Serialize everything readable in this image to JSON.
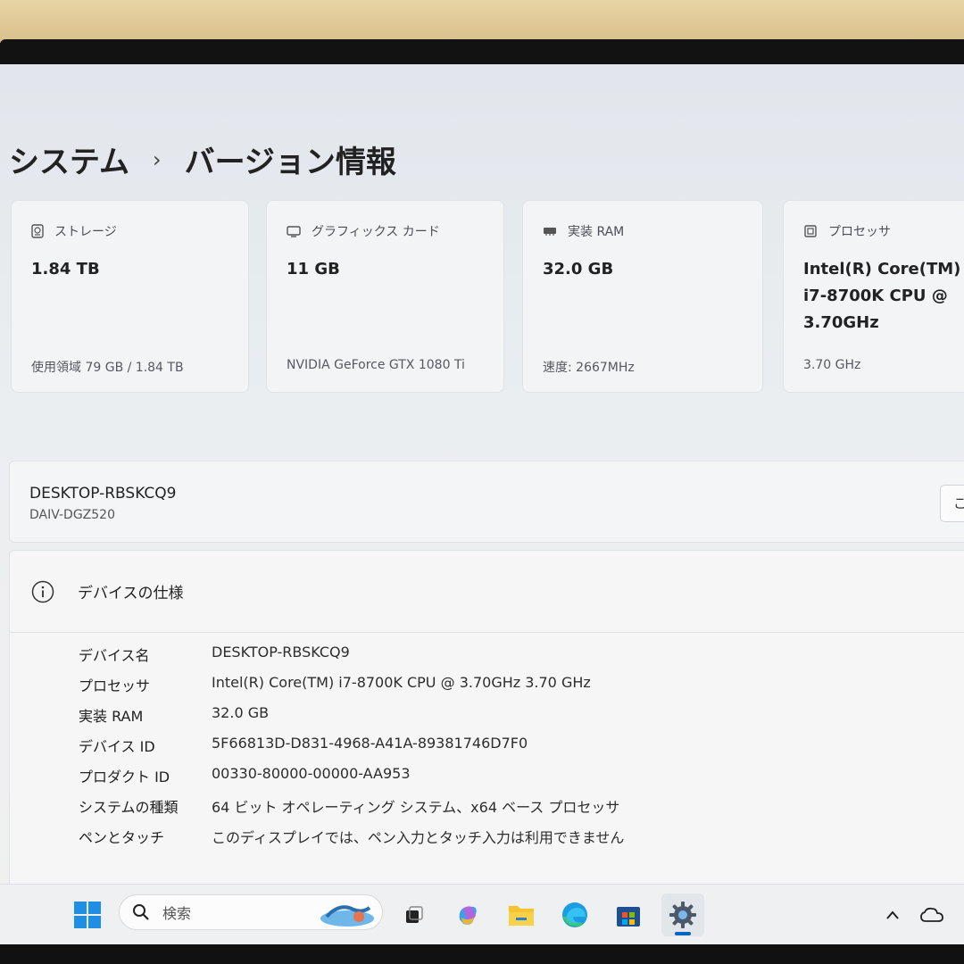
{
  "page": {
    "breadcrumb_parent": "システム",
    "breadcrumb_separator": "›",
    "breadcrumb_current": "バージョン情報"
  },
  "cards": [
    {
      "label": "ストレージ",
      "icon": "storage-icon",
      "value": "1.84 TB",
      "sub": "使用領域 79 GB / 1.84 TB"
    },
    {
      "label": "グラフィックス カード",
      "icon": "display-icon",
      "value": "11 GB",
      "sub": "NVIDIA GeForce GTX 1080 Ti"
    },
    {
      "label": "実装 RAM",
      "icon": "memory-icon",
      "value": "32.0 GB",
      "sub": "速度: 2667MHz"
    },
    {
      "label": "プロセッサ",
      "icon": "processor-icon",
      "value": "Intel(R) Core(TM) i7-8700K CPU @ 3.70GHz",
      "sub": "3.70 GHz"
    }
  ],
  "device": {
    "name": "DESKTOP-RBSKCQ9",
    "model": "DAIV-DGZ520",
    "rename_label": "こ"
  },
  "specs": {
    "title": "デバイスの仕様",
    "rows": [
      {
        "key": "デバイス名",
        "value": "DESKTOP-RBSKCQ9"
      },
      {
        "key": "プロセッサ",
        "value": "Intel(R) Core(TM) i7-8700K CPU @ 3.70GHz   3.70 GHz"
      },
      {
        "key": "実装 RAM",
        "value": "32.0 GB"
      },
      {
        "key": "デバイス ID",
        "value": "5F66813D-D831-4968-A41A-89381746D7F0"
      },
      {
        "key": "プロダクト ID",
        "value": "00330-80000-00000-AA953"
      },
      {
        "key": "システムの種類",
        "value": "64 ビット オペレーティング システム、x64 ベース プロセッサ"
      },
      {
        "key": "ペンとタッチ",
        "value": "このディスプレイでは、ペン入力とタッチ入力は利用できません"
      }
    ]
  },
  "taskbar": {
    "search_placeholder": "検索",
    "apps": [
      "start-icon",
      "task-view-icon",
      "copilot-icon",
      "file-explorer-icon",
      "edge-icon",
      "store-icon",
      "settings-icon"
    ],
    "tray": [
      "chevron-up-icon",
      "cloud-icon"
    ]
  },
  "colors": {
    "accent": "#0067c0",
    "card_bg": "#f3f4f6",
    "screen_bg": "#ebeef1"
  }
}
